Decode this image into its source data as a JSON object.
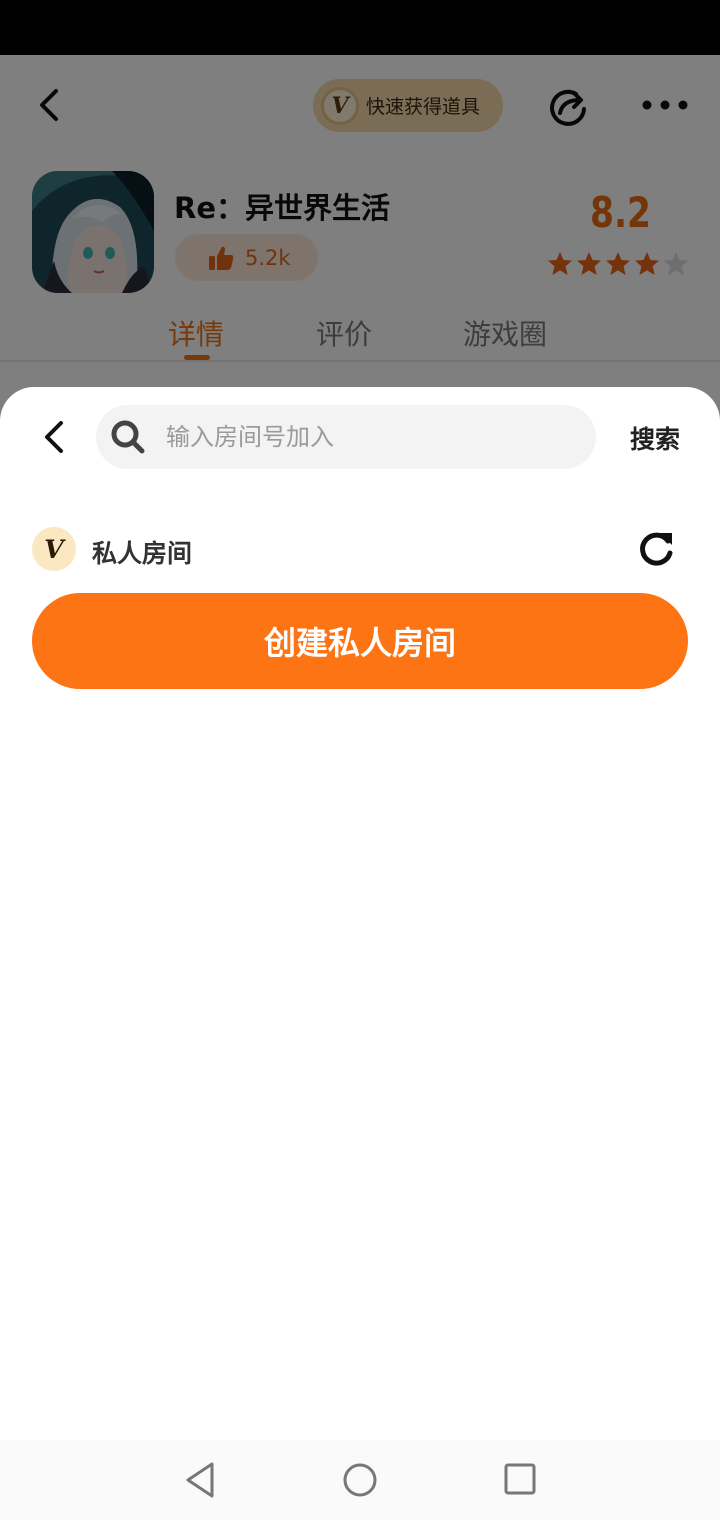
{
  "header": {
    "quick_pill_label": "快速获得道具",
    "vcoin_letter": "V"
  },
  "game": {
    "title": "Re：异世界生活",
    "likes": "5.2k",
    "score": "8.2",
    "stars_filled": 4,
    "stars_total": 5
  },
  "tabs": [
    {
      "label": "详情",
      "active": true
    },
    {
      "label": "评价",
      "active": false
    },
    {
      "label": "游戏圈",
      "active": false
    }
  ],
  "sheet": {
    "search": {
      "placeholder": "输入房间号加入",
      "value": "",
      "button_label": "搜索"
    },
    "private_room": {
      "badge_letter": "V",
      "label": "私人房间"
    },
    "create_button_label": "创建私人房间"
  },
  "colors": {
    "accent": "#fd7414",
    "tab_active": "#f07216",
    "star": "#e8641a"
  }
}
